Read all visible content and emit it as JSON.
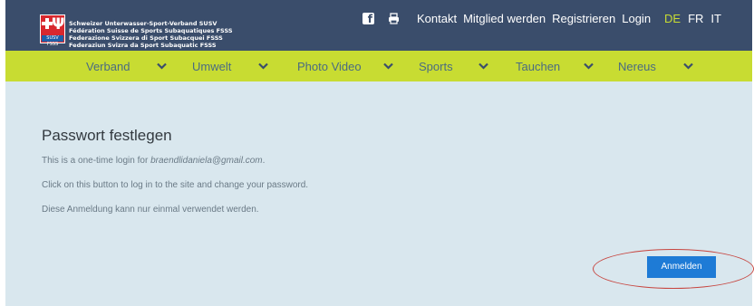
{
  "org": {
    "lines": [
      "Schweizer Unterwasser-Sport-Verband SUSV",
      "Fédération Suisse de Sports Subaquatiques FSSS",
      "Federazione Svizzera di Sport Subacquei FSSS",
      "Federaziun Svizra da Sport Subaquatic FSSS"
    ],
    "logo_tag": "SUSV FSSS"
  },
  "topnav": {
    "links": [
      "Kontakt",
      "Mitglied werden",
      "Registrieren",
      "Login"
    ]
  },
  "languages": [
    {
      "code": "DE",
      "active": true
    },
    {
      "code": "FR",
      "active": false
    },
    {
      "code": "IT",
      "active": false
    }
  ],
  "mainnav": {
    "items": [
      "Verband",
      "Umwelt",
      "Photo Video",
      "Sports",
      "Tauchen",
      "Nereus"
    ]
  },
  "content": {
    "title": "Passwort festlegen",
    "line1_prefix": "This is a one-time login for ",
    "line1_email": "braendlidaniela@gmail.com",
    "line1_suffix": ".",
    "line2": "Click on this button to log in to the site and change your password.",
    "line3": "Diese Anmeldung kann nur einmal verwendet werden.",
    "button_label": "Anmelden"
  },
  "colors": {
    "header_bg": "#3a4d6b",
    "nav_bg": "#c8dc32",
    "content_bg": "#d9e7ee",
    "button_bg": "#1e7bd6",
    "active_lang": "#c8dc32",
    "highlight_ring": "#c7453f"
  },
  "icons": [
    "facebook-icon",
    "print-icon",
    "chevron-down-icon"
  ]
}
